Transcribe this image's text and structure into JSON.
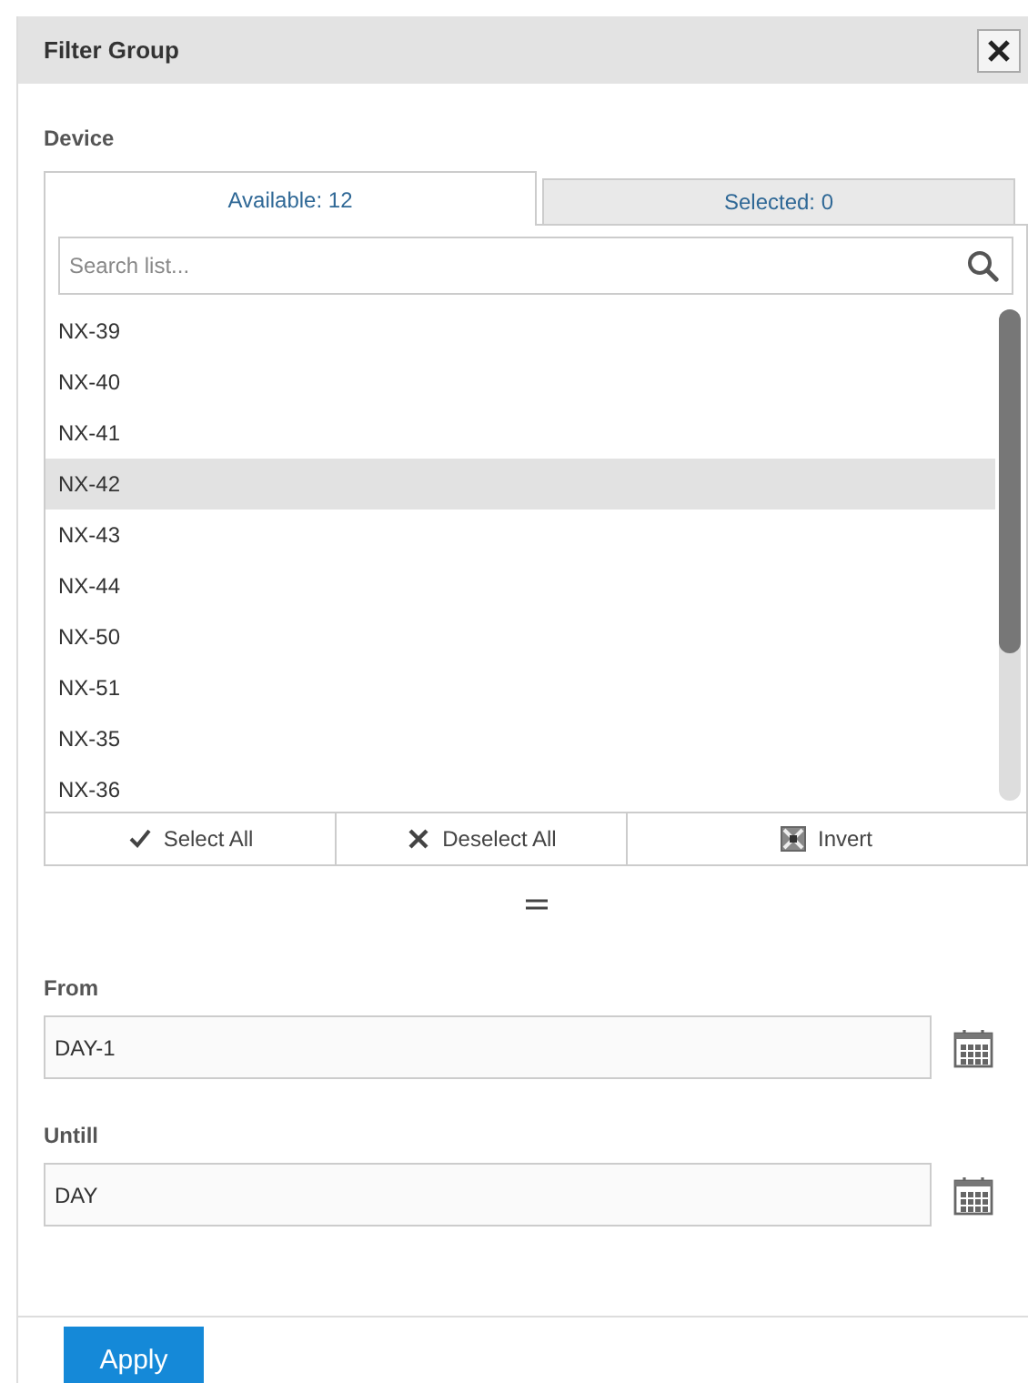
{
  "dialog": {
    "title": "Filter Group"
  },
  "device": {
    "label": "Device",
    "tabs": [
      {
        "label": "Available: 12",
        "selected": true
      },
      {
        "label": "Selected: 0",
        "selected": false
      }
    ],
    "search": {
      "placeholder": "Search list..."
    },
    "items": [
      {
        "label": "NX-39",
        "selected": false
      },
      {
        "label": "NX-40",
        "selected": false
      },
      {
        "label": "NX-41",
        "selected": false
      },
      {
        "label": "NX-42",
        "selected": true
      },
      {
        "label": "NX-43",
        "selected": false
      },
      {
        "label": "NX-44",
        "selected": false
      },
      {
        "label": "NX-50",
        "selected": false
      },
      {
        "label": "NX-51",
        "selected": false
      },
      {
        "label": "NX-35",
        "selected": false
      },
      {
        "label": "NX-36",
        "selected": false
      }
    ],
    "actions": [
      {
        "kind": "check",
        "label": "Select All"
      },
      {
        "kind": "cross",
        "label": "Deselect All"
      },
      {
        "kind": "invert",
        "label": "Invert"
      }
    ]
  },
  "fields": [
    {
      "label": "From",
      "value": "DAY-1"
    },
    {
      "label": "Untill",
      "value": "DAY"
    }
  ],
  "buttons": [
    {
      "label": "Apply"
    }
  ]
}
